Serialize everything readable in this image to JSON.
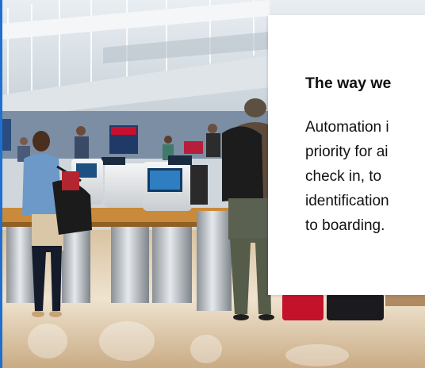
{
  "hero": {
    "image_alt": "Airport check-in area with self-service kiosks and travelers with luggage",
    "kiosk_sign_text": "DELTA"
  },
  "card": {
    "heading": "The way we",
    "body_lines": [
      "Automation i",
      "priority for ai",
      "check in, to",
      "identification",
      "to boarding."
    ]
  },
  "colors": {
    "accent_blue": "#1f6fd1",
    "card_bg": "#ffffff",
    "text": "#111111"
  }
}
